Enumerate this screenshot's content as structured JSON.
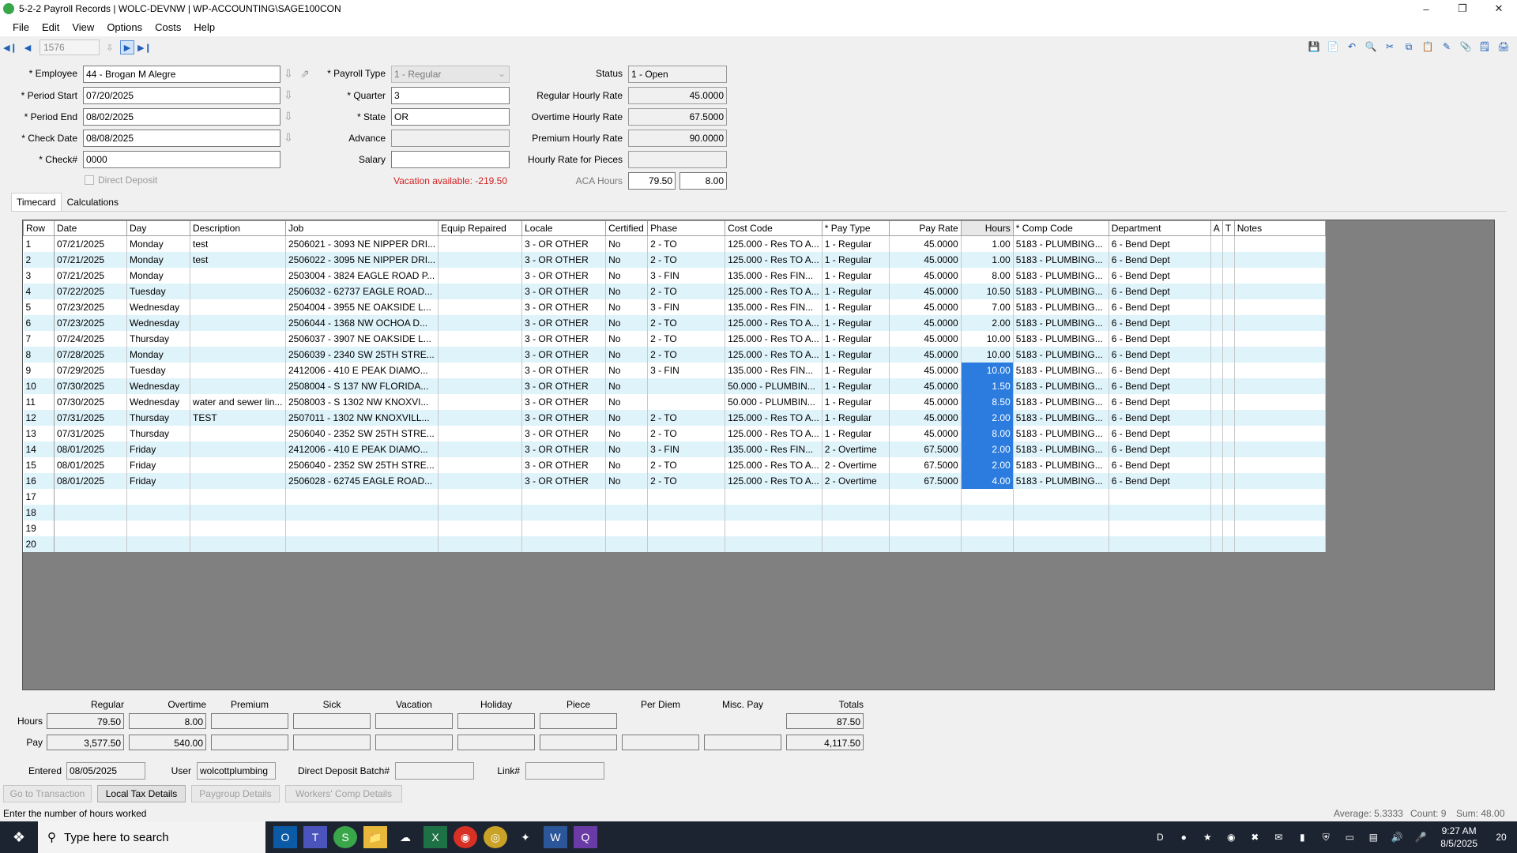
{
  "window": {
    "title": "5-2-2 Payroll Records  |  WOLC-DEVNW  |  WP-ACCOUNTING\\SAGE100CON"
  },
  "menu": [
    "File",
    "Edit",
    "View",
    "Options",
    "Costs",
    "Help"
  ],
  "toolbar": {
    "record_number": "1576"
  },
  "form": {
    "employee_label": "* Employee",
    "employee_value": "44 - Brogan M Alegre",
    "period_start_label": "* Period Start",
    "period_start_value": "07/20/2025",
    "period_end_label": "* Period End",
    "period_end_value": "08/02/2025",
    "check_date_label": "* Check Date",
    "check_date_value": "08/08/2025",
    "check_no_label": "* Check#",
    "check_no_value": "0000",
    "direct_deposit_label": "Direct Deposit",
    "payroll_type_label": "* Payroll Type",
    "payroll_type_value": "1 - Regular",
    "quarter_label": "* Quarter",
    "quarter_value": "3",
    "state_label": "* State",
    "state_value": "OR",
    "advance_label": "Advance",
    "advance_value": "",
    "salary_label": "Salary",
    "salary_value": "",
    "vacation_text": "Vacation available:  -219.50",
    "status_label": "Status",
    "status_value": "1 - Open",
    "regular_rate_label": "Regular Hourly Rate",
    "regular_rate_value": "45.0000",
    "overtime_rate_label": "Overtime Hourly Rate",
    "overtime_rate_value": "67.5000",
    "premium_rate_label": "Premium Hourly Rate",
    "premium_rate_value": "90.0000",
    "pieces_rate_label": "Hourly Rate for Pieces",
    "pieces_rate_value": "",
    "aca_label": "ACA Hours",
    "aca_value1": "79.50",
    "aca_value2": "8.00"
  },
  "tabs": [
    "Timecard",
    "Calculations"
  ],
  "grid": {
    "columns": [
      "Row",
      "Date",
      "Day",
      "Description",
      "Job",
      "Equip Repaired",
      "Locale",
      "Certified",
      "Phase",
      "Cost Code",
      "* Pay Type",
      "Pay Rate",
      "Hours",
      "* Comp Code",
      "Department",
      "A",
      "T",
      "Notes"
    ],
    "rows": [
      [
        "1",
        "07/21/2025",
        "Monday",
        "test",
        "2506021 - 3093 NE NIPPER DRI...",
        "",
        "3 - OR OTHER",
        "No",
        "2 - TO",
        "125.000 - Res TO A...",
        "1 - Regular",
        "45.0000",
        "1.00",
        "5183 - PLUMBING...",
        "6 - Bend Dept",
        "",
        "",
        ""
      ],
      [
        "2",
        "07/21/2025",
        "Monday",
        "test",
        "2506022 - 3095 NE NIPPER DRI...",
        "",
        "3 - OR OTHER",
        "No",
        "2 - TO",
        "125.000 - Res TO A...",
        "1 - Regular",
        "45.0000",
        "1.00",
        "5183 - PLUMBING...",
        "6 - Bend Dept",
        "",
        "",
        ""
      ],
      [
        "3",
        "07/21/2025",
        "Monday",
        "",
        "2503004 - 3824 EAGLE ROAD P...",
        "",
        "3 - OR OTHER",
        "No",
        "3 - FIN",
        "135.000 - Res FIN...",
        "1 - Regular",
        "45.0000",
        "8.00",
        "5183 - PLUMBING...",
        "6 - Bend Dept",
        "",
        "",
        ""
      ],
      [
        "4",
        "07/22/2025",
        "Tuesday",
        "",
        "2506032 - 62737 EAGLE ROAD...",
        "",
        "3 - OR OTHER",
        "No",
        "2 - TO",
        "125.000 - Res TO A...",
        "1 - Regular",
        "45.0000",
        "10.50",
        "5183 - PLUMBING...",
        "6 - Bend Dept",
        "",
        "",
        ""
      ],
      [
        "5",
        "07/23/2025",
        "Wednesday",
        "",
        "2504004 - 3955 NE OAKSIDE L...",
        "",
        "3 - OR OTHER",
        "No",
        "3 - FIN",
        "135.000 - Res FIN...",
        "1 - Regular",
        "45.0000",
        "7.00",
        "5183 - PLUMBING...",
        "6 - Bend Dept",
        "",
        "",
        ""
      ],
      [
        "6",
        "07/23/2025",
        "Wednesday",
        "",
        "2506044 - 1368 NW OCHOA D...",
        "",
        "3 - OR OTHER",
        "No",
        "2 - TO",
        "125.000 - Res TO A...",
        "1 - Regular",
        "45.0000",
        "2.00",
        "5183 - PLUMBING...",
        "6 - Bend Dept",
        "",
        "",
        ""
      ],
      [
        "7",
        "07/24/2025",
        "Thursday",
        "",
        "2506037 - 3907 NE OAKSIDE L...",
        "",
        "3 - OR OTHER",
        "No",
        "2 - TO",
        "125.000 - Res TO A...",
        "1 - Regular",
        "45.0000",
        "10.00",
        "5183 - PLUMBING...",
        "6 - Bend Dept",
        "",
        "",
        ""
      ],
      [
        "8",
        "07/28/2025",
        "Monday",
        "",
        "2506039 - 2340 SW 25TH STRE...",
        "",
        "3 - OR OTHER",
        "No",
        "2 - TO",
        "125.000 - Res TO A...",
        "1 - Regular",
        "45.0000",
        "10.00",
        "5183 - PLUMBING...",
        "6 - Bend Dept",
        "",
        "",
        ""
      ],
      [
        "9",
        "07/29/2025",
        "Tuesday",
        "",
        "2412006 - 410 E PEAK DIAMO...",
        "",
        "3 - OR OTHER",
        "No",
        "3 - FIN",
        "135.000 - Res FIN...",
        "1 - Regular",
        "45.0000",
        "10.00",
        "5183 - PLUMBING...",
        "6 - Bend Dept",
        "",
        "",
        ""
      ],
      [
        "10",
        "07/30/2025",
        "Wednesday",
        "",
        "2508004 - S 137 NW FLORIDA...",
        "",
        "3 - OR OTHER",
        "No",
        "",
        "50.000 - PLUMBIN...",
        "1 - Regular",
        "45.0000",
        "1.50",
        "5183 - PLUMBING...",
        "6 - Bend Dept",
        "",
        "",
        ""
      ],
      [
        "11",
        "07/30/2025",
        "Wednesday",
        "water and sewer lin...",
        "2508003 - S 1302 NW KNOXVI...",
        "",
        "3 - OR OTHER",
        "No",
        "",
        "50.000 - PLUMBIN...",
        "1 - Regular",
        "45.0000",
        "8.50",
        "5183 - PLUMBING...",
        "6 - Bend Dept",
        "",
        "",
        ""
      ],
      [
        "12",
        "07/31/2025",
        "Thursday",
        "TEST",
        "2507011 - 1302 NW KNOXVILL...",
        "",
        "3 - OR OTHER",
        "No",
        "2 - TO",
        "125.000 - Res TO A...",
        "1 - Regular",
        "45.0000",
        "2.00",
        "5183 - PLUMBING...",
        "6 - Bend Dept",
        "",
        "",
        ""
      ],
      [
        "13",
        "07/31/2025",
        "Thursday",
        "",
        "2506040 - 2352 SW 25TH STRE...",
        "",
        "3 - OR OTHER",
        "No",
        "2 - TO",
        "125.000 - Res TO A...",
        "1 - Regular",
        "45.0000",
        "8.00",
        "5183 - PLUMBING...",
        "6 - Bend Dept",
        "",
        "",
        ""
      ],
      [
        "14",
        "08/01/2025",
        "Friday",
        "",
        "2412006 - 410 E PEAK DIAMO...",
        "",
        "3 - OR OTHER",
        "No",
        "3 - FIN",
        "135.000 - Res FIN...",
        "2 - Overtime",
        "67.5000",
        "2.00",
        "5183 - PLUMBING...",
        "6 - Bend Dept",
        "",
        "",
        ""
      ],
      [
        "15",
        "08/01/2025",
        "Friday",
        "",
        "2506040 - 2352 SW 25TH STRE...",
        "",
        "3 - OR OTHER",
        "No",
        "2 - TO",
        "125.000 - Res TO A...",
        "2 - Overtime",
        "67.5000",
        "2.00",
        "5183 - PLUMBING...",
        "6 - Bend Dept",
        "",
        "",
        ""
      ],
      [
        "16",
        "08/01/2025",
        "Friday",
        "",
        "2506028 - 62745 EAGLE ROAD...",
        "",
        "3 - OR OTHER",
        "No",
        "2 - TO",
        "125.000 - Res TO A...",
        "2 - Overtime",
        "67.5000",
        "4.00",
        "5183 - PLUMBING...",
        "6 - Bend Dept",
        "",
        "",
        ""
      ],
      [
        "17",
        "",
        "",
        "",
        "",
        "",
        "",
        "",
        "",
        "",
        "",
        "",
        "",
        "",
        "",
        "",
        "",
        ""
      ],
      [
        "18",
        "",
        "",
        "",
        "",
        "",
        "",
        "",
        "",
        "",
        "",
        "",
        "",
        "",
        "",
        "",
        "",
        ""
      ],
      [
        "19",
        "",
        "",
        "",
        "",
        "",
        "",
        "",
        "",
        "",
        "",
        "",
        "",
        "",
        "",
        "",
        "",
        ""
      ],
      [
        "20",
        "",
        "",
        "",
        "",
        "",
        "",
        "",
        "",
        "",
        "",
        "",
        "",
        "",
        "",
        "",
        "",
        ""
      ]
    ],
    "selected_hours_rows": [
      9,
      10,
      11,
      12,
      13,
      14,
      15,
      16
    ]
  },
  "summary": {
    "headers": [
      "Regular",
      "Overtime",
      "Premium",
      "Sick",
      "Vacation",
      "Holiday",
      "Piece",
      "Per Diem",
      "Misc. Pay",
      "Totals"
    ],
    "hours_label": "Hours",
    "pay_label": "Pay",
    "hours_values": [
      "79.50",
      "8.00",
      "",
      "",
      "",
      "",
      "",
      "",
      "",
      "87.50"
    ],
    "pay_values": [
      "3,577.50",
      "540.00",
      "",
      "",
      "",
      "",
      "",
      "",
      "",
      "4,117.50"
    ]
  },
  "footer": {
    "entered_label": "Entered",
    "entered_value": "08/05/2025",
    "user_label": "User",
    "user_value": "wolcottplumbing",
    "ddbatch_label": "Direct Deposit Batch#",
    "ddbatch_value": "",
    "link_label": "Link#",
    "link_value": ""
  },
  "buttons": {
    "goto": "Go to Transaction",
    "localtax": "Local Tax Details",
    "paygroup": "Paygroup Details",
    "workerscomp": "Workers' Comp Details"
  },
  "status": {
    "hint": "Enter the number of hours worked",
    "average": "Average: 5.3333",
    "count": "Count: 9",
    "sum": "Sum: 48.00"
  },
  "taskbar": {
    "search_placeholder": "Type here to search",
    "time": "9:27 AM",
    "date": "8/5/2025",
    "notifications": "20"
  }
}
